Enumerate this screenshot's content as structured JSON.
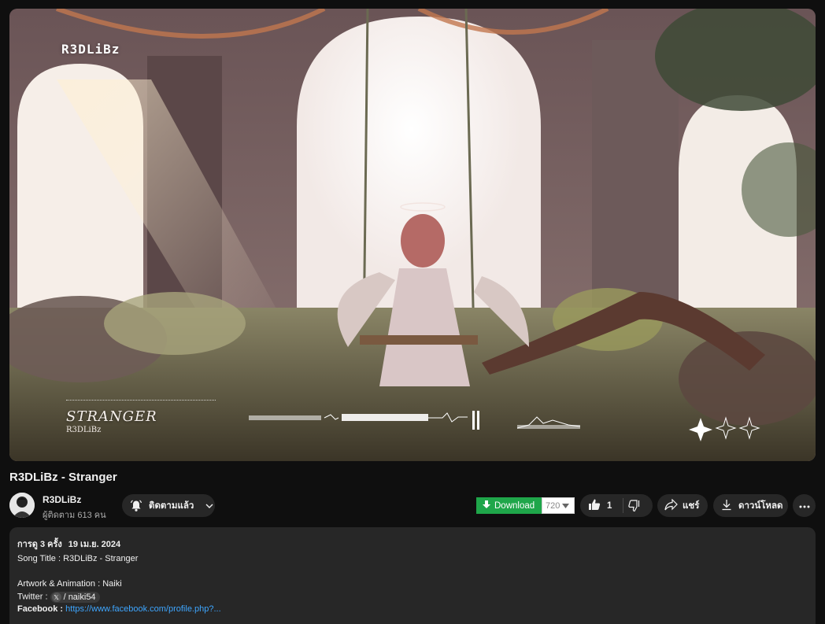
{
  "player": {
    "watermark": "R3DLiBz",
    "overlay_title": "STRANGER",
    "overlay_artist": "R3DLiBz"
  },
  "video": {
    "title": "R3DLiBz - Stranger"
  },
  "channel": {
    "name": "R3DLiBz",
    "subscribers": "ผู้ติดตาม 613 คน",
    "subscribe_label": "ติดตามแล้ว"
  },
  "actions": {
    "download_ext_label": "Download",
    "download_quality": "720",
    "like_count": "1",
    "share_label": "แชร์",
    "download_label": "ดาวน์โหลด"
  },
  "description": {
    "views": "การดู 3 ครั้ง",
    "date": "19 เม.ย. 2024",
    "song_title": "Song Title : R3DLiBz  - Stranger",
    "artwork": "Artwork & Animation : Naiki",
    "twitter_label": "Twitter :",
    "twitter_handle": "/ naiki54",
    "facebook_label": "Facebook :",
    "facebook_link": "https://www.facebook.com/profile.php?..."
  },
  "icons": [
    "bell-icon",
    "chevron-down-icon",
    "download-arrow-icon",
    "dropdown-caret-icon",
    "thumbs-up-icon",
    "thumbs-down-icon",
    "share-arrow-icon",
    "download-icon",
    "more-dots-icon",
    "x-logo-icon"
  ],
  "colors": {
    "background": "#0f0f0f",
    "surface": "#272727",
    "download_green": "#1fa64a",
    "link_blue": "#3ea6ff"
  }
}
